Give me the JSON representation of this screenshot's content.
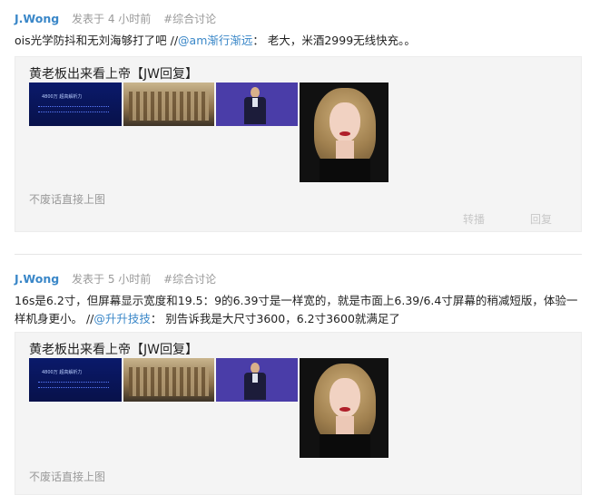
{
  "posts": [
    {
      "author": "J.Wong",
      "time": "发表于 4 小时前",
      "tag": "#综合讨论",
      "text_before": "ois光学防抖和无刘海够打了吧 //",
      "mention": "@am渐行渐远",
      "text_after": "：  老大，米酒2999无线快充。。",
      "quote": {
        "title": "黄老板出来看上帝【JW回复】",
        "slide_text": "4800万 超高解析力",
        "caption": "不废话直接上图",
        "repost_label": "转播",
        "reply_label": "回复"
      }
    },
    {
      "author": "J.Wong",
      "time": "发表于 5 小时前",
      "tag": "#综合讨论",
      "text_before": "16s是6.2寸，但屏幕显示宽度和19.5：9的6.39寸是一样宽的，就是市面上6.39/6.4寸屏幕的稍减短版，体验一样机身更小。 //",
      "mention": "@升升技技",
      "text_after": "：  别告诉我是大尺寸3600，6.2寸3600就满足了",
      "quote": {
        "title": "黄老板出来看上帝【JW回复】",
        "slide_text": "4800万 超高解析力",
        "caption": "不废话直接上图"
      }
    }
  ],
  "colors": {
    "link": "#3a87c8",
    "meta": "#999999",
    "quote_bg": "#f4f4f4"
  }
}
